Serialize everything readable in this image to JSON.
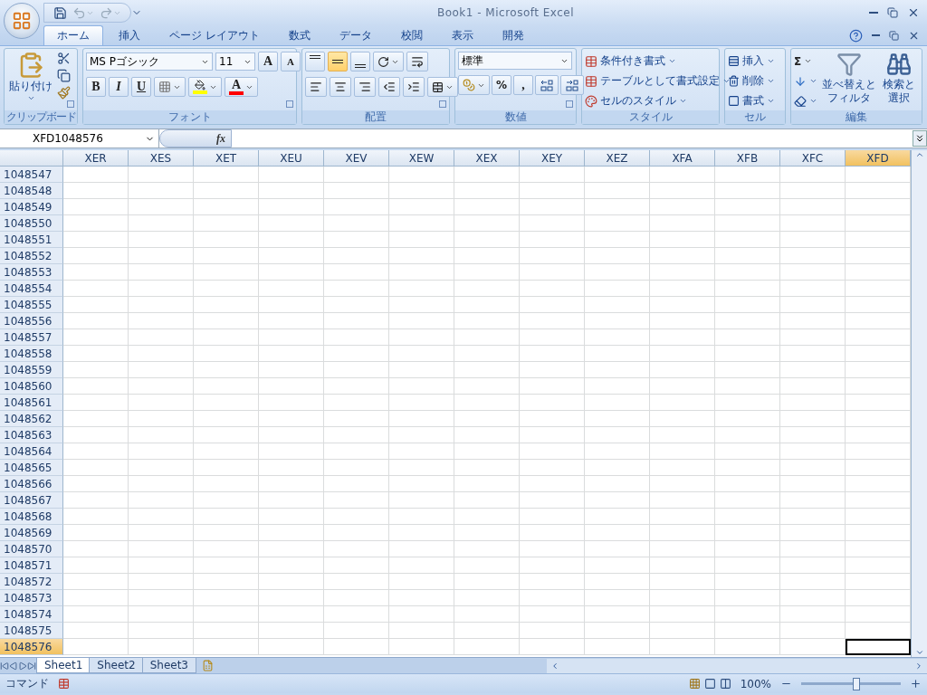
{
  "window": {
    "title": "Book1 - Microsoft Excel"
  },
  "tabs": [
    {
      "label": "ホーム",
      "selected": true
    },
    {
      "label": "挿入",
      "selected": false
    },
    {
      "label": "ページ レイアウト",
      "selected": false
    },
    {
      "label": "数式",
      "selected": false
    },
    {
      "label": "データ",
      "selected": false
    },
    {
      "label": "校閲",
      "selected": false
    },
    {
      "label": "表示",
      "selected": false
    },
    {
      "label": "開発",
      "selected": false
    }
  ],
  "ribbon": {
    "clipboard": {
      "label": "クリップボード",
      "paste": "貼り付け"
    },
    "font": {
      "label": "フォント",
      "font_name": "MS Pゴシック",
      "font_size": "11",
      "grow": "A",
      "shrink": "A",
      "bold": "B",
      "italic": "I",
      "underline": "U",
      "font_color": "A"
    },
    "alignment": {
      "label": "配置",
      "vertical": [
        {
          "selected": false
        },
        {
          "selected": true
        },
        {
          "selected": false
        }
      ]
    },
    "number": {
      "label": "数値",
      "format": "標準",
      "percent": "%",
      "comma": ","
    },
    "styles": {
      "label": "スタイル",
      "items": [
        "条件付き書式",
        "テーブルとして書式設定",
        "セルのスタイル"
      ]
    },
    "cells": {
      "label": "セル",
      "items": [
        "挿入",
        "削除",
        "書式"
      ]
    },
    "editing": {
      "label": "編集",
      "sum": "Σ",
      "sort": [
        "並べ替えと",
        "フィルタ"
      ],
      "find": [
        "検索と",
        "選択"
      ]
    }
  },
  "formula_bar": {
    "name_box": "XFD1048576",
    "fx": "fx"
  },
  "grid": {
    "columns": [
      {
        "label": "XER",
        "selected": false
      },
      {
        "label": "XES",
        "selected": false
      },
      {
        "label": "XET",
        "selected": false
      },
      {
        "label": "XEU",
        "selected": false
      },
      {
        "label": "XEV",
        "selected": false
      },
      {
        "label": "XEW",
        "selected": false
      },
      {
        "label": "XEX",
        "selected": false
      },
      {
        "label": "XEY",
        "selected": false
      },
      {
        "label": "XEZ",
        "selected": false
      },
      {
        "label": "XFA",
        "selected": false
      },
      {
        "label": "XFB",
        "selected": false
      },
      {
        "label": "XFC",
        "selected": false
      },
      {
        "label": "XFD",
        "selected": true
      }
    ],
    "rows": [
      {
        "label": "1048547",
        "selected": false
      },
      {
        "label": "1048548",
        "selected": false
      },
      {
        "label": "1048549",
        "selected": false
      },
      {
        "label": "1048550",
        "selected": false
      },
      {
        "label": "1048551",
        "selected": false
      },
      {
        "label": "1048552",
        "selected": false
      },
      {
        "label": "1048553",
        "selected": false
      },
      {
        "label": "1048554",
        "selected": false
      },
      {
        "label": "1048555",
        "selected": false
      },
      {
        "label": "1048556",
        "selected": false
      },
      {
        "label": "1048557",
        "selected": false
      },
      {
        "label": "1048558",
        "selected": false
      },
      {
        "label": "1048559",
        "selected": false
      },
      {
        "label": "1048560",
        "selected": false
      },
      {
        "label": "1048561",
        "selected": false
      },
      {
        "label": "1048562",
        "selected": false
      },
      {
        "label": "1048563",
        "selected": false
      },
      {
        "label": "1048564",
        "selected": false
      },
      {
        "label": "1048565",
        "selected": false
      },
      {
        "label": "1048566",
        "selected": false
      },
      {
        "label": "1048567",
        "selected": false
      },
      {
        "label": "1048568",
        "selected": false
      },
      {
        "label": "1048569",
        "selected": false
      },
      {
        "label": "1048570",
        "selected": false
      },
      {
        "label": "1048571",
        "selected": false
      },
      {
        "label": "1048572",
        "selected": false
      },
      {
        "label": "1048573",
        "selected": false
      },
      {
        "label": "1048574",
        "selected": false
      },
      {
        "label": "1048575",
        "selected": false
      },
      {
        "label": "1048576",
        "selected": true
      }
    ]
  },
  "sheet_tabs": [
    {
      "label": "Sheet1",
      "selected": true
    },
    {
      "label": "Sheet2",
      "selected": false
    },
    {
      "label": "Sheet3",
      "selected": false
    }
  ],
  "status_bar": {
    "mode": "コマンド",
    "zoom": "100%",
    "zoom_slider": {
      "level": 0.55
    }
  }
}
